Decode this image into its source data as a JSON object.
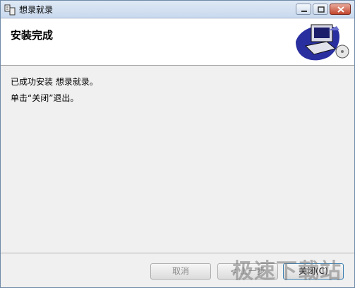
{
  "window": {
    "title": "想录就录",
    "icon": "setup-icon",
    "controls": [
      "minimize-icon",
      "maximize-icon",
      "close-icon"
    ]
  },
  "banner": {
    "title": "安装完成",
    "art": "computer-install-graphic"
  },
  "body": {
    "line1": "已成功安装 想录就录。",
    "line2": "单击“关闭”退出。"
  },
  "footer": {
    "cancel_label": "取消",
    "back_label": "< 上一步",
    "close_label": "关闭(C)"
  },
  "watermark": "极速下载站",
  "colors": {
    "titlebar": "#c9d9ee",
    "banner_bg": "#ffffff",
    "dialog_bg": "#f0f0f0",
    "disabled_text": "#8c8c8c"
  }
}
